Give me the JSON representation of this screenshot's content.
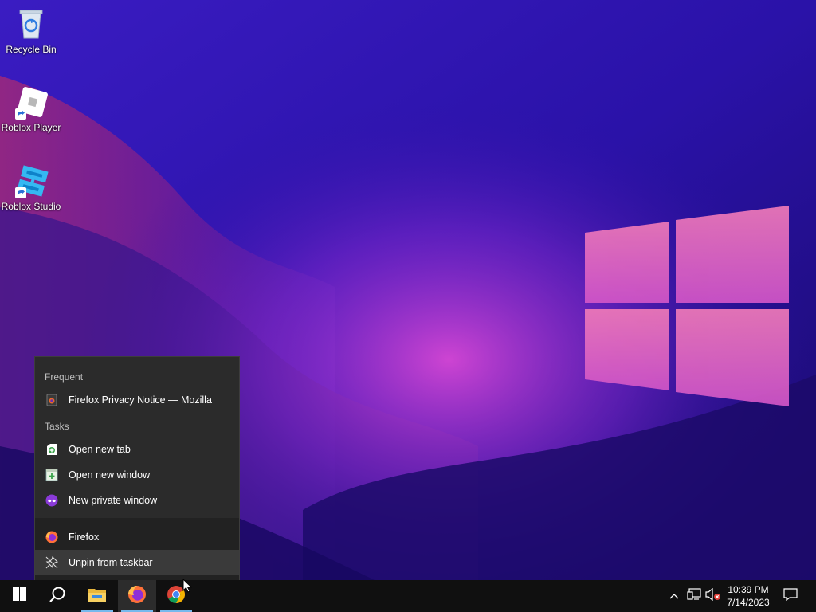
{
  "desktop": {
    "icons": [
      {
        "label": "Recycle Bin",
        "icon": "recycle-bin-icon"
      },
      {
        "label": "Roblox Player",
        "icon": "roblox-player-icon"
      },
      {
        "label": "Roblox Studio",
        "icon": "roblox-studio-icon"
      }
    ]
  },
  "jumplist": {
    "frequent_header": "Frequent",
    "frequent": [
      {
        "label": "Firefox Privacy Notice — Mozilla",
        "icon": "firefox-page-icon"
      }
    ],
    "tasks_header": "Tasks",
    "tasks": [
      {
        "label": "Open new tab",
        "icon": "new-tab-icon"
      },
      {
        "label": "Open new window",
        "icon": "new-window-icon"
      },
      {
        "label": "New private window",
        "icon": "private-mask-icon"
      }
    ],
    "app": {
      "label": "Firefox",
      "icon": "firefox-icon"
    },
    "unpin": {
      "label": "Unpin from taskbar",
      "icon": "unpin-icon"
    }
  },
  "taskbar": {
    "apps": [
      {
        "name": "start",
        "icon": "windows-logo-icon"
      },
      {
        "name": "search",
        "icon": "search-icon"
      },
      {
        "name": "file-explorer",
        "icon": "folder-icon"
      },
      {
        "name": "firefox",
        "icon": "firefox-icon"
      },
      {
        "name": "chrome",
        "icon": "chrome-icon"
      }
    ],
    "clock": {
      "time": "10:39 PM",
      "date": "7/14/2023"
    }
  },
  "colors": {
    "accent": "#76b9ed",
    "menu_bg": "#2b2b2b",
    "taskbar_bg": "#101010"
  }
}
